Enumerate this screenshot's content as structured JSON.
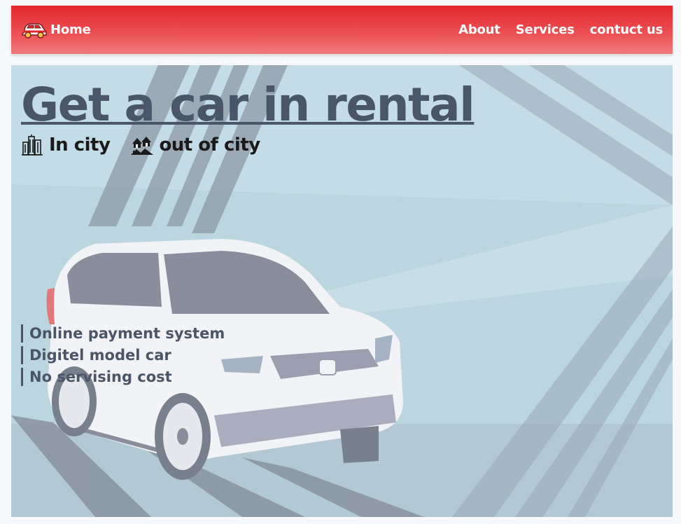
{
  "nav": {
    "home_label": "Home",
    "links": [
      "About",
      "Services",
      "contuct us"
    ],
    "brand_icon": "car-icon",
    "accent_color": "#e2262c"
  },
  "hero": {
    "title": "Get a car in rental",
    "locations": [
      {
        "icon": "city-icon",
        "label": "In city"
      },
      {
        "icon": "countryside-icon",
        "label": "out of city"
      }
    ],
    "features": [
      "Online payment system",
      "Digitel model car",
      "No servising cost"
    ],
    "background_color": "#bcd6e0",
    "text_color": "#4a5567"
  }
}
